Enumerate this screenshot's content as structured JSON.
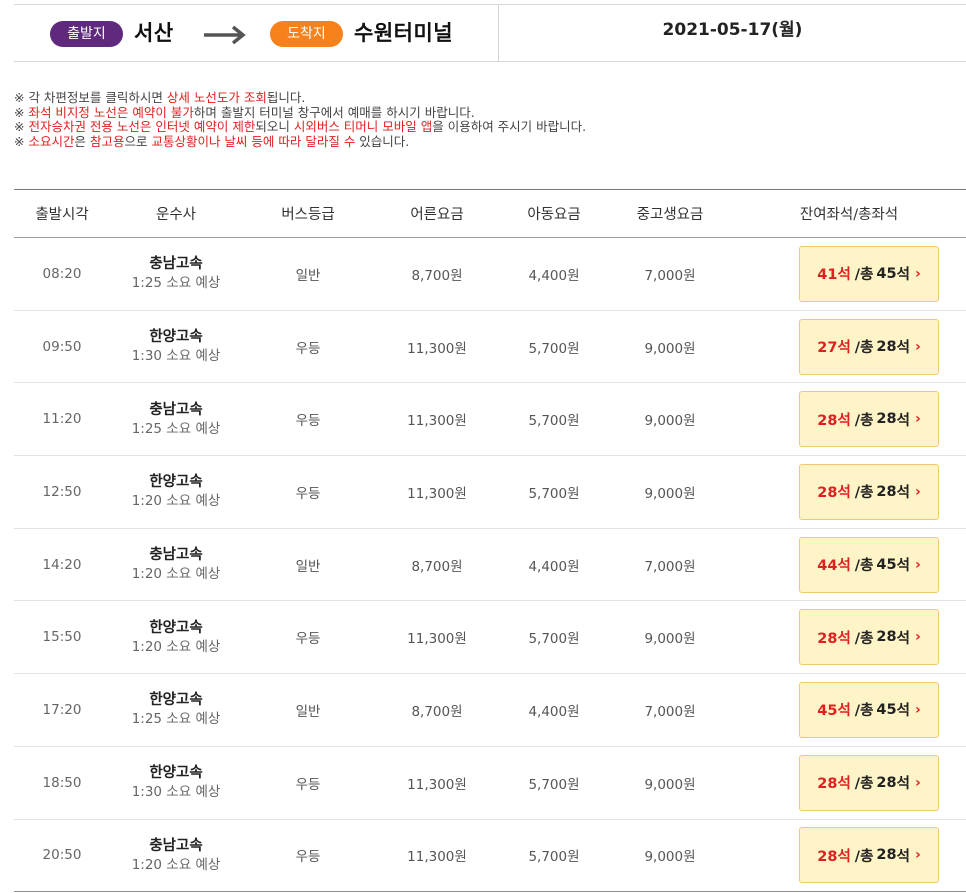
{
  "route": {
    "departure_badge": "출발지",
    "departure_city": "서산",
    "arrival_badge": "도착지",
    "arrival_city": "수원터미널",
    "date": "2021-05-17(월)"
  },
  "colors": {
    "departure_badge": "#5f2a7e",
    "arrival_badge": "#f7821c",
    "highlight": "#e02020",
    "seat_button_bg": "#fff4c8"
  },
  "notices": [
    [
      {
        "t": "※ 각 차편정보를 클릭하시면 ",
        "hl": false
      },
      {
        "t": "상세 노선도가 조회",
        "hl": true
      },
      {
        "t": "됩니다.",
        "hl": false
      }
    ],
    [
      {
        "t": "※ ",
        "hl": false
      },
      {
        "t": "좌석 비지정 노선은 예약이 불가",
        "hl": true
      },
      {
        "t": "하며 출발지 터미널 창구에서 예매를 하시기 바랍니다.",
        "hl": false
      }
    ],
    [
      {
        "t": "※ ",
        "hl": false
      },
      {
        "t": "전자승차권 전용 노선은 인터넷 예약이 제한",
        "hl": true
      },
      {
        "t": "되오니 ",
        "hl": false
      },
      {
        "t": "시외버스 티머니 모바일 앱",
        "hl": true
      },
      {
        "t": "을 이용하여 주시기 바랍니다.",
        "hl": false
      }
    ],
    [
      {
        "t": "※ ",
        "hl": false
      },
      {
        "t": "소요시간",
        "hl": true
      },
      {
        "t": "은 ",
        "hl": false
      },
      {
        "t": "참고용",
        "hl": true
      },
      {
        "t": "으로 ",
        "hl": false
      },
      {
        "t": "교통상황이나 날씨 등에 따라 달라질 수",
        "hl": true
      },
      {
        "t": " 있습니다.",
        "hl": false
      }
    ]
  ],
  "table": {
    "headers": [
      "출발시각",
      "운수사",
      "버스등급",
      "어른요금",
      "아동요금",
      "중고생요금",
      "잔여좌석/총좌석"
    ],
    "seat_unit": "석",
    "total_prefix": "/총",
    "rows": [
      {
        "time": "08:20",
        "company": "충남고속",
        "duration": "1:25 소요 예상",
        "grade": "일반",
        "adult": "8,700원",
        "child": "4,400원",
        "teen": "7,000원",
        "remaining": 41,
        "total": 45
      },
      {
        "time": "09:50",
        "company": "한양고속",
        "duration": "1:30 소요 예상",
        "grade": "우등",
        "adult": "11,300원",
        "child": "5,700원",
        "teen": "9,000원",
        "remaining": 27,
        "total": 28
      },
      {
        "time": "11:20",
        "company": "충남고속",
        "duration": "1:25 소요 예상",
        "grade": "우등",
        "adult": "11,300원",
        "child": "5,700원",
        "teen": "9,000원",
        "remaining": 28,
        "total": 28
      },
      {
        "time": "12:50",
        "company": "한양고속",
        "duration": "1:20 소요 예상",
        "grade": "우등",
        "adult": "11,300원",
        "child": "5,700원",
        "teen": "9,000원",
        "remaining": 28,
        "total": 28
      },
      {
        "time": "14:20",
        "company": "충남고속",
        "duration": "1:20 소요 예상",
        "grade": "일반",
        "adult": "8,700원",
        "child": "4,400원",
        "teen": "7,000원",
        "remaining": 44,
        "total": 45
      },
      {
        "time": "15:50",
        "company": "한양고속",
        "duration": "1:20 소요 예상",
        "grade": "우등",
        "adult": "11,300원",
        "child": "5,700원",
        "teen": "9,000원",
        "remaining": 28,
        "total": 28
      },
      {
        "time": "17:20",
        "company": "한양고속",
        "duration": "1:25 소요 예상",
        "grade": "일반",
        "adult": "8,700원",
        "child": "4,400원",
        "teen": "7,000원",
        "remaining": 45,
        "total": 45
      },
      {
        "time": "18:50",
        "company": "한양고속",
        "duration": "1:30 소요 예상",
        "grade": "우등",
        "adult": "11,300원",
        "child": "5,700원",
        "teen": "9,000원",
        "remaining": 28,
        "total": 28
      },
      {
        "time": "20:50",
        "company": "충남고속",
        "duration": "1:20 소요 예상",
        "grade": "우등",
        "adult": "11,300원",
        "child": "5,700원",
        "teen": "9,000원",
        "remaining": 28,
        "total": 28
      }
    ]
  }
}
